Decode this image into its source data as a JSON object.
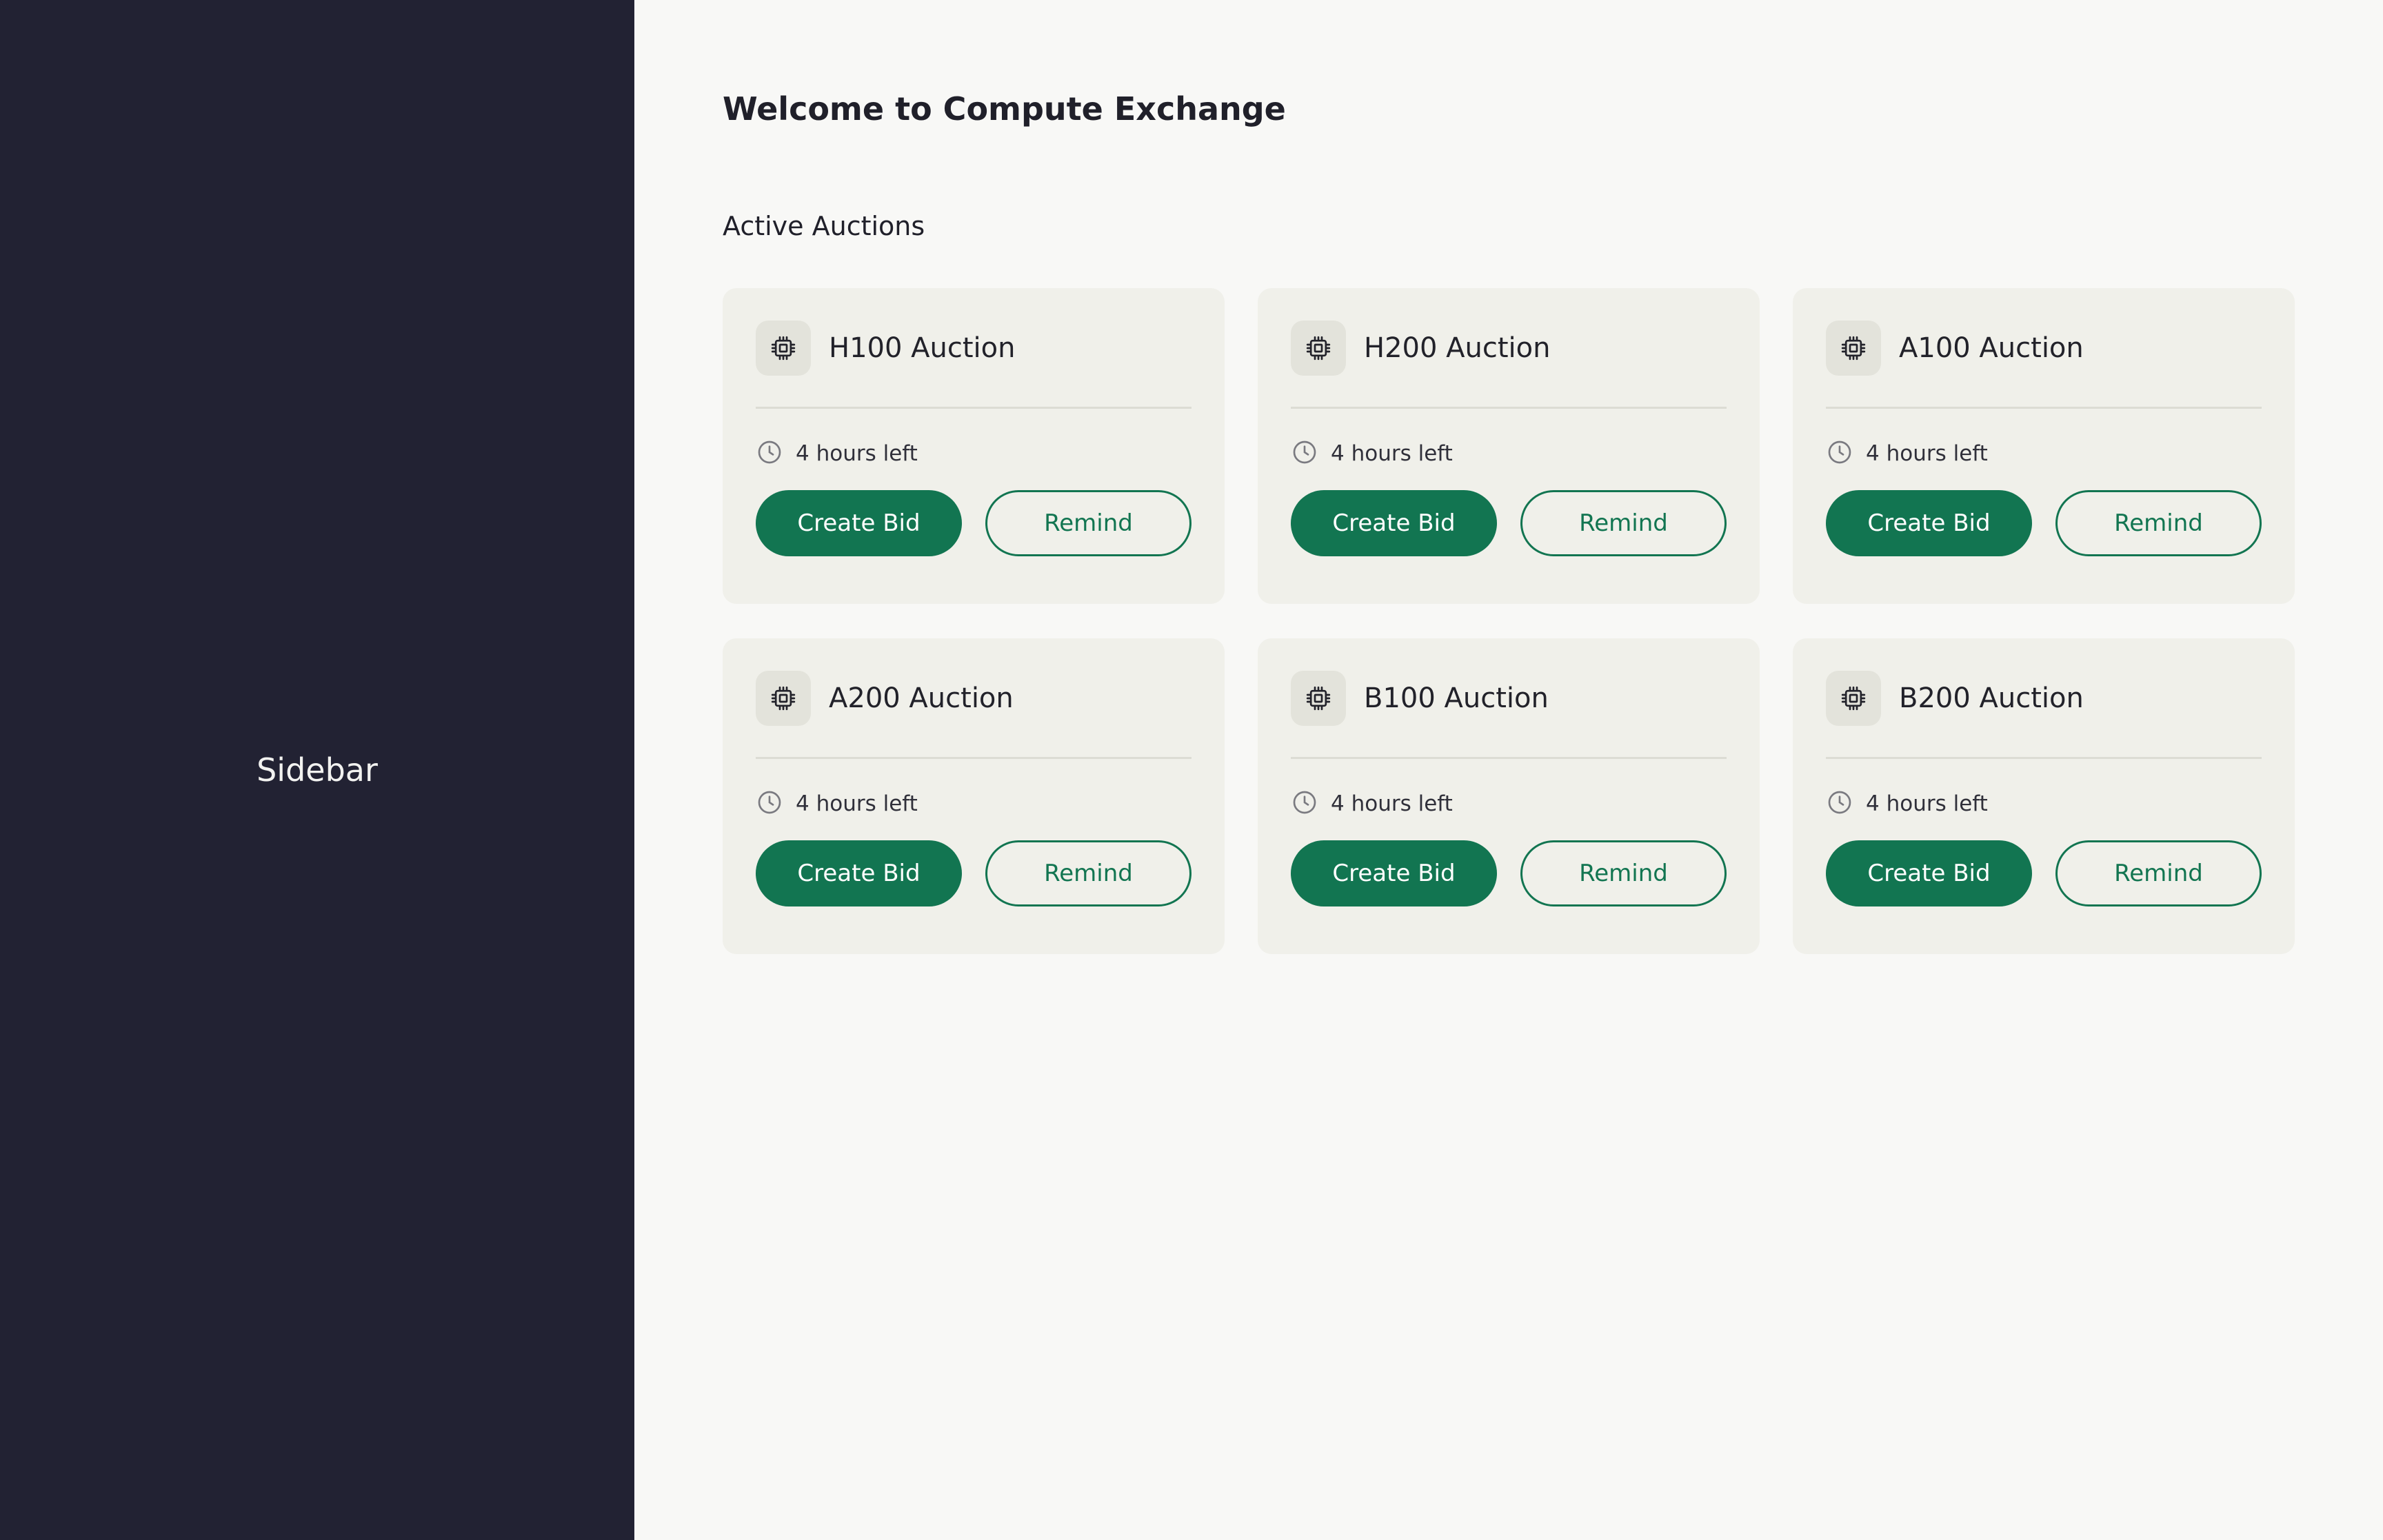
{
  "sidebar": {
    "label": "Sidebar"
  },
  "main": {
    "title": "Welcome to Compute Exchange",
    "section_title": "Active Auctions",
    "auctions": [
      {
        "name": "H100 Auction",
        "time_left": "4 hours left",
        "bid_label": "Create Bid",
        "remind_label": "Remind"
      },
      {
        "name": "H200 Auction",
        "time_left": "4 hours left",
        "bid_label": "Create Bid",
        "remind_label": "Remind"
      },
      {
        "name": "A100 Auction",
        "time_left": "4 hours left",
        "bid_label": "Create Bid",
        "remind_label": "Remind"
      },
      {
        "name": "A200 Auction",
        "time_left": "4 hours left",
        "bid_label": "Create Bid",
        "remind_label": "Remind"
      },
      {
        "name": "B100 Auction",
        "time_left": "4 hours left",
        "bid_label": "Create Bid",
        "remind_label": "Remind"
      },
      {
        "name": "B200 Auction",
        "time_left": "4 hours left",
        "bid_label": "Create Bid",
        "remind_label": "Remind"
      }
    ]
  },
  "icons": {
    "card_icon": "cpu-chip-icon",
    "time_icon": "clock-icon"
  },
  "colors": {
    "sidebar_bg": "#222233",
    "main_bg": "#f8f8f6",
    "card_bg": "#f0f0ea",
    "accent": "#127551",
    "text": "#20202a"
  }
}
